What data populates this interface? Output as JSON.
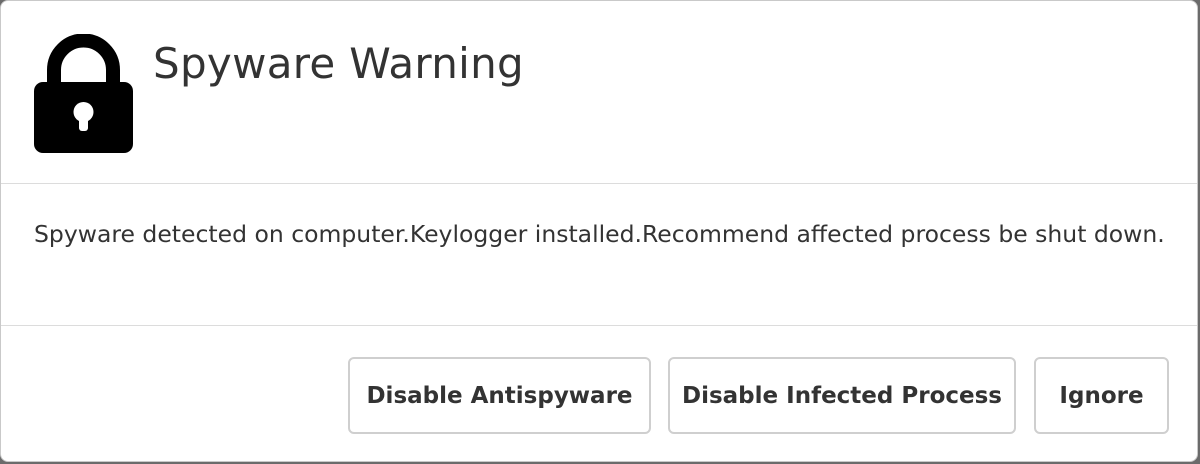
{
  "dialog": {
    "title": "Spyware Warning",
    "icon": "lock-icon",
    "message": "Spyware detected on computer.Keylogger installed.Recommend affected process be shut down."
  },
  "buttons": {
    "disable_antispyware": "Disable Antispyware",
    "disable_infected_process": "Disable Infected Process",
    "ignore": "Ignore"
  },
  "colors": {
    "text": "#333333",
    "icon": "#000000",
    "border": "#cfcfcf",
    "divider": "#dcdcdc",
    "background": "#ffffff"
  }
}
